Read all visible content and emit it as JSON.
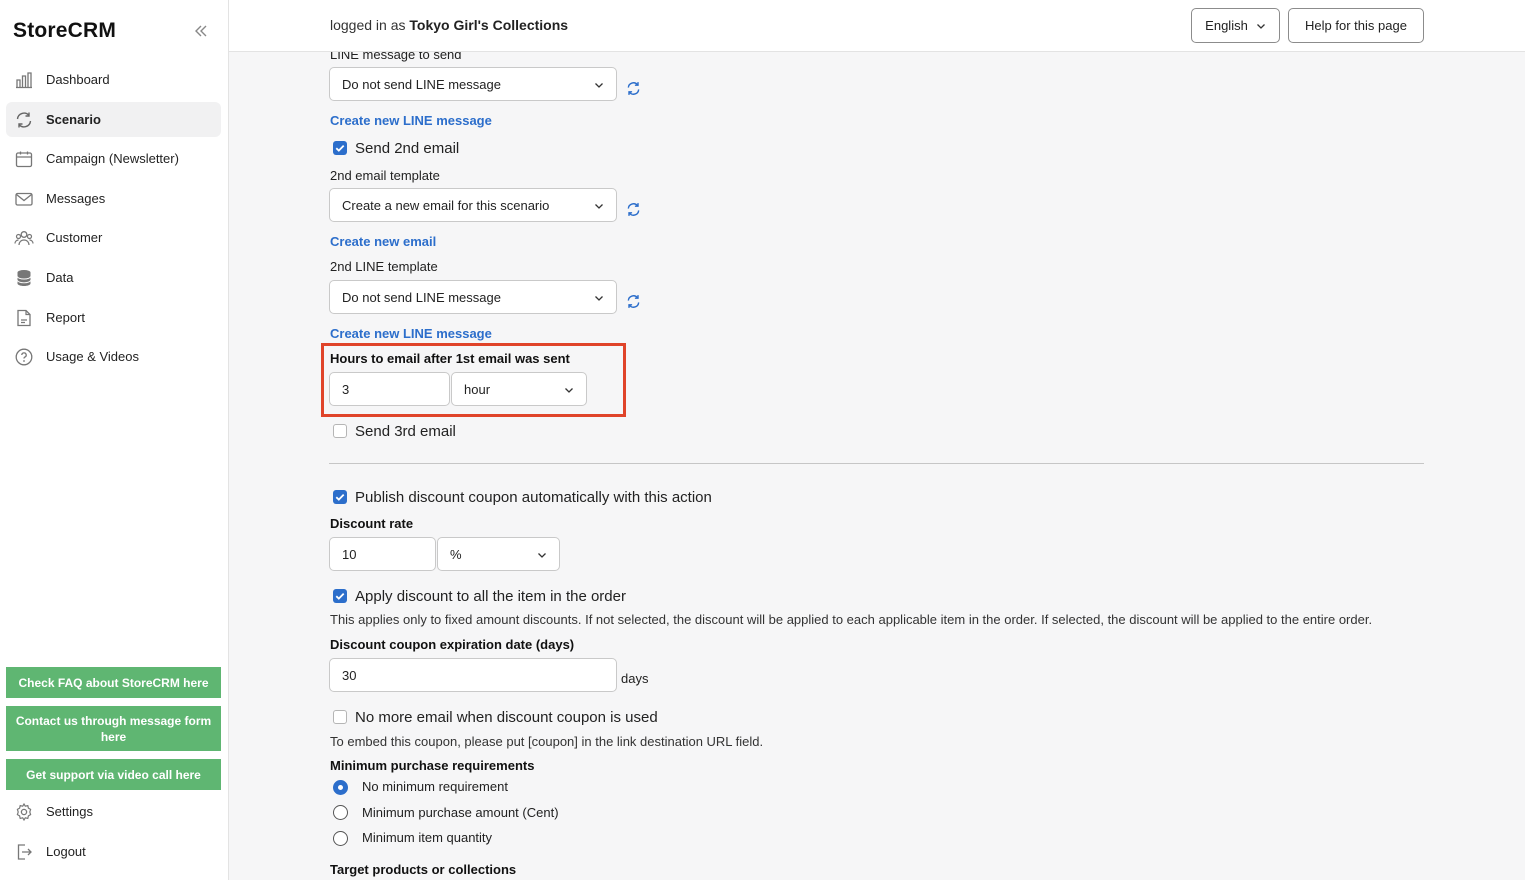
{
  "app": {
    "name": "StoreCRM"
  },
  "sidebar": {
    "items": [
      {
        "label": "Dashboard",
        "icon": "chart-bar-icon"
      },
      {
        "label": "Scenario",
        "icon": "refresh-cycle-icon",
        "active": true
      },
      {
        "label": "Campaign (Newsletter)",
        "icon": "calendar-icon"
      },
      {
        "label": "Messages",
        "icon": "mail-icon"
      },
      {
        "label": "Customer",
        "icon": "people-icon"
      },
      {
        "label": "Data",
        "icon": "database-icon"
      },
      {
        "label": "Report",
        "icon": "document-icon"
      },
      {
        "label": "Usage & Videos",
        "icon": "question-circle-icon"
      }
    ],
    "support_buttons": [
      "Check FAQ about StoreCRM here",
      "Contact us through message form here",
      "Get support via video call here"
    ],
    "settings_label": "Settings",
    "logout_label": "Logout"
  },
  "header": {
    "logged_in_prefix": "logged in as",
    "store_name": "Tokyo Girl's Collections",
    "language": "English",
    "help_button": "Help for this page"
  },
  "form": {
    "line_message_label": "LINE message to send",
    "line_message_value": "Do not send LINE message",
    "create_line_link_1": "Create new LINE message",
    "send_2nd_email_label": "Send 2nd email",
    "send_2nd_email_checked": true,
    "second_email_template_label": "2nd email template",
    "second_email_template_value": "Create a new email for this scenario",
    "create_email_link": "Create new email",
    "second_line_template_label": "2nd LINE template",
    "second_line_template_value": "Do not send LINE message",
    "create_line_link_2": "Create new LINE message",
    "hours_label": "Hours to email after 1st email was sent",
    "hours_value": "3",
    "hours_unit": "hour",
    "send_3rd_email_label": "Send 3rd email",
    "send_3rd_email_checked": false,
    "publish_coupon_label": "Publish discount coupon automatically with this action",
    "publish_coupon_checked": true,
    "discount_rate_label": "Discount rate",
    "discount_rate_value": "10",
    "discount_rate_unit": "%",
    "apply_all_label": "Apply discount to all the item in the order",
    "apply_all_checked": true,
    "apply_all_help": "This applies only to fixed amount discounts. If not selected, the discount will be applied to each applicable item in the order. If selected, the discount will be applied to the entire order.",
    "expiration_label": "Discount coupon expiration date (days)",
    "expiration_value": "30",
    "expiration_unit": "days",
    "no_more_email_label": "No more email when discount coupon is used",
    "no_more_email_checked": false,
    "embed_help": "To embed this coupon, please put [coupon] in the link destination URL field.",
    "min_purchase_label": "Minimum purchase requirements",
    "min_purchase_options": [
      {
        "label": "No minimum requirement",
        "selected": true
      },
      {
        "label": "Minimum purchase amount (Cent)",
        "selected": false
      },
      {
        "label": "Minimum item quantity",
        "selected": false
      }
    ],
    "target_label": "Target products or collections"
  },
  "colors": {
    "accent": "#2c6ecb",
    "support_green": "#5fb672",
    "highlight_red": "#e0442a"
  }
}
